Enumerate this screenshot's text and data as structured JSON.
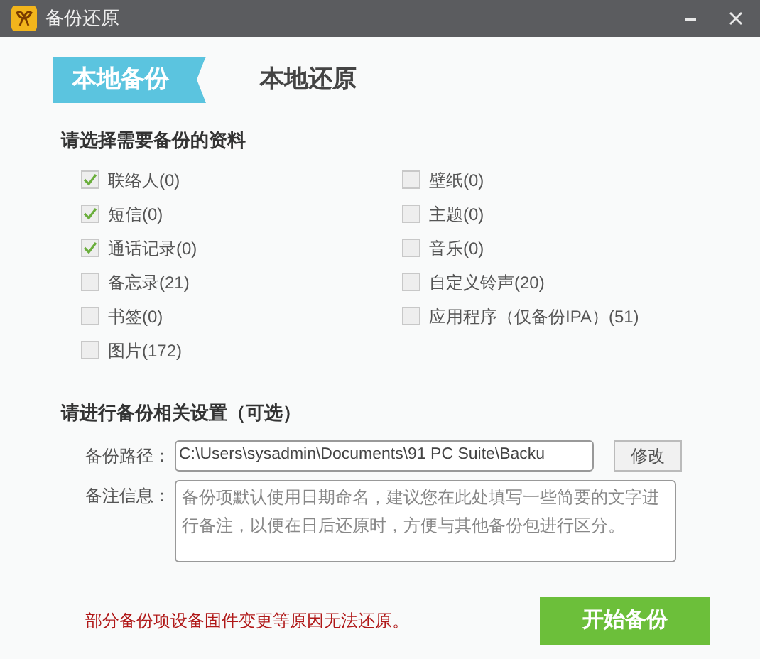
{
  "window": {
    "title": "备份还原"
  },
  "tabs": [
    {
      "label": "本地备份",
      "selected": true
    },
    {
      "label": "本地还原",
      "selected": false
    }
  ],
  "data_section": {
    "heading": "请选择需要备份的资料",
    "items": [
      {
        "label": "联络人(0)",
        "checked": true
      },
      {
        "label": "壁纸(0)",
        "checked": false
      },
      {
        "label": "短信(0)",
        "checked": true
      },
      {
        "label": "主题(0)",
        "checked": false
      },
      {
        "label": "通话记录(0)",
        "checked": true
      },
      {
        "label": "音乐(0)",
        "checked": false
      },
      {
        "label": "备忘录(21)",
        "checked": false
      },
      {
        "label": "自定义铃声(20)",
        "checked": false
      },
      {
        "label": "书签(0)",
        "checked": false
      },
      {
        "label": "应用程序（仅备份IPA）(51)",
        "checked": false
      },
      {
        "label": "图片(172)",
        "checked": false
      }
    ]
  },
  "settings_section": {
    "heading": "请进行备份相关设置（可选）",
    "path": {
      "label": "备份路径：",
      "value": "C:\\Users\\sysadmin\\Documents\\91 PC Suite\\Backu",
      "button": "修改"
    },
    "note": {
      "label": "备注信息：",
      "placeholder": "备份项默认使用日期命名，建议您在此处填写一些简要的文字进行备注，以便在日后还原时，方便与其他备份包进行区分。"
    }
  },
  "warning": "部分备份项设备固件变更等原因无法还原。",
  "start_button": "开始备份"
}
